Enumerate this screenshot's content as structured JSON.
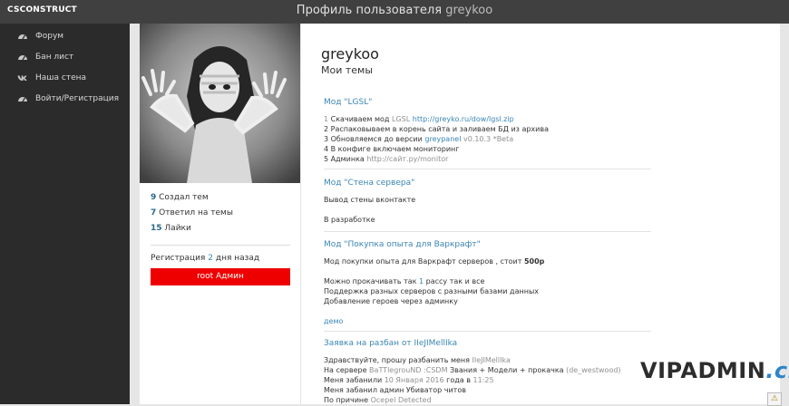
{
  "brand": "CSCONSTRUCT",
  "header": {
    "title_prefix": "Профиль пользователя",
    "title_user": "greykoo"
  },
  "sidebar": {
    "items": [
      {
        "label": "Форум",
        "icon": "dashboard-icon"
      },
      {
        "label": "Бан лист",
        "icon": "dashboard-icon"
      },
      {
        "label": "Наша стена",
        "icon": "vk-icon"
      },
      {
        "label": "Войти/Регистрация",
        "icon": "dashboard-icon"
      }
    ]
  },
  "profile": {
    "stats": [
      {
        "value": "9",
        "label": "Создал тем"
      },
      {
        "value": "7",
        "label": "Ответил на темы"
      },
      {
        "value": "15",
        "label": "Лайки"
      }
    ],
    "reg_prefix": "Регистрация",
    "reg_value": "2",
    "reg_suffix": "дня назад",
    "role": "root Админ"
  },
  "main": {
    "username": "greykoo",
    "themes_heading": "Мои темы",
    "topics": [
      {
        "title": "Мод \"LGSL\"",
        "lines": [
          [
            "1 Скачиваем мод ",
            "LGSL ",
            "http://greyko.ru/dow/lgsl.zip"
          ],
          [
            "2 Распаковываем в корень сайта и заливаем БД из архива"
          ],
          [
            "3 Обновляемся до версии ",
            "greypanel ",
            "v0.10.3 *Beta"
          ],
          [
            "4 В конфиге включаем мониторинг"
          ],
          [
            "5 Админка ",
            "http://сайт.ру/monitor"
          ]
        ]
      },
      {
        "title": "Мод \"Стена сервера\"",
        "lines": [
          [
            "Вывод стены вконтакте"
          ],
          [
            ""
          ],
          [
            "В разработке"
          ]
        ]
      },
      {
        "title": "Мод \"Покупка опыта для Варкрафт\"",
        "lines": [
          [
            "Мод покупки опыта для Варкрафт серверов , стоит ",
            "500р"
          ],
          [
            ""
          ],
          [
            "Можно прокачивать так ",
            "1",
            " рассу так и все"
          ],
          [
            "Поддержка разных серверов с разными базами данных"
          ],
          [
            "Добавление героев через админку"
          ],
          [
            ""
          ],
          [
            "демо"
          ]
        ]
      },
      {
        "title": "Заявка на разбан от IIeJIMellIka",
        "lines": [
          [
            "Здравствуйте, прошу разбанить меня ",
            "IIeJIMellIka"
          ],
          [
            "На сервере ",
            "BaTTlegrouND :CSDM",
            " Звания + Модели + прокачка ",
            "(de_westwood)"
          ],
          [
            "Меня забанили ",
            "10 Января 2016",
            " года в ",
            "11:25"
          ],
          [
            "Меня забанил админ Убиватор читов"
          ],
          [
            "По причине ",
            "Ocepel Detected"
          ]
        ]
      }
    ]
  },
  "watermark": {
    "name": "VIPADMIN",
    "domain": ".club"
  },
  "warning_icon": "warning-icon"
}
